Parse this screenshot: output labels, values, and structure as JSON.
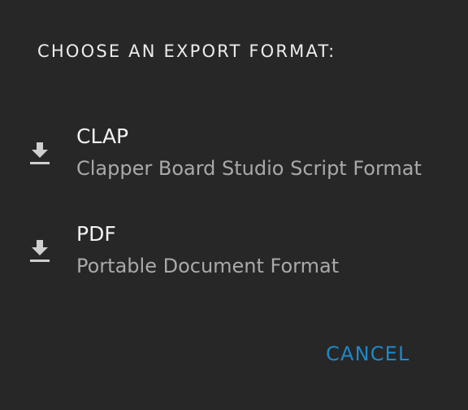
{
  "dialog": {
    "title": "CHOOSE AN EXPORT FORMAT:",
    "options": [
      {
        "icon": "download-icon",
        "label": "CLAP",
        "description": "Clapper Board Studio Script Format"
      },
      {
        "icon": "download-icon",
        "label": "PDF",
        "description": "Portable Document Format"
      }
    ],
    "cancel_label": "CANCEL"
  },
  "colors": {
    "background": "#272727",
    "title_text": "#ececec",
    "option_label": "#f2f2f2",
    "option_description": "#a9a9a9",
    "icon": "#cfcfcf",
    "accent": "#1f88c8"
  }
}
